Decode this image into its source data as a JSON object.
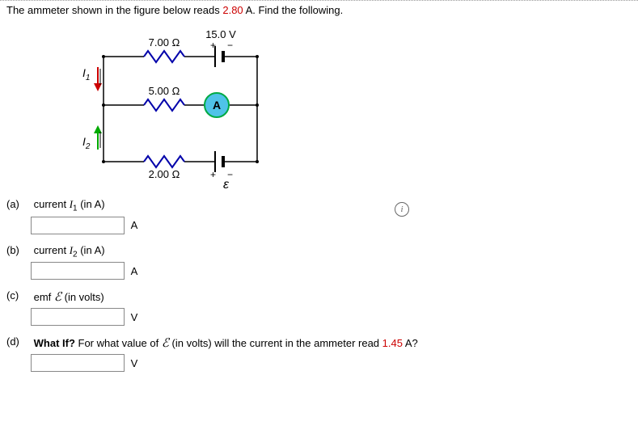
{
  "problem": {
    "text_before": "The ammeter shown in the figure below reads ",
    "ammeter_reading": "2.80",
    "text_after": " A. Find the following."
  },
  "circuit": {
    "r_top": "7.00 Ω",
    "r_mid": "5.00 Ω",
    "r_bot": "2.00 Ω",
    "v_top": "15.0 V",
    "ammeter_label": "A",
    "emf_symbol": "ε",
    "I1": "I",
    "I1_sub": "1",
    "I2": "I",
    "I2_sub": "2",
    "plus": "+",
    "minus": "−"
  },
  "info_icon": "i",
  "parts": {
    "a": {
      "label": "(a)",
      "text_prefix": "current ",
      "var": "I",
      "sub": "1",
      "text_suffix": " (in A)",
      "unit": "A"
    },
    "b": {
      "label": "(b)",
      "text_prefix": "current ",
      "var": "I",
      "sub": "2",
      "text_suffix": " (in A)",
      "unit": "A"
    },
    "c": {
      "label": "(c)",
      "text_prefix": "emf ",
      "var": "ℰ",
      "text_suffix": " (in volts)",
      "unit": "V"
    },
    "d": {
      "label": "(d)",
      "bold_prefix": "What If?",
      "text_mid1": " For what value of ",
      "var": "ℰ",
      "text_mid2": " (in volts) will the current in the ammeter read ",
      "new_reading": "1.45",
      "text_suffix": " A?",
      "unit": "V"
    }
  }
}
